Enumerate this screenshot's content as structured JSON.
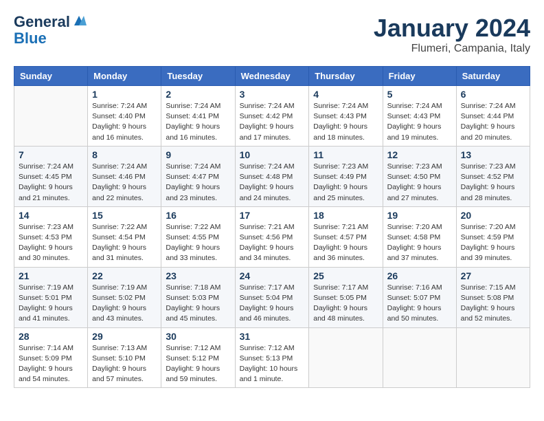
{
  "header": {
    "logo_line1": "General",
    "logo_line2": "Blue",
    "month_title": "January 2024",
    "location": "Flumeri, Campania, Italy"
  },
  "weekdays": [
    "Sunday",
    "Monday",
    "Tuesday",
    "Wednesday",
    "Thursday",
    "Friday",
    "Saturday"
  ],
  "weeks": [
    [
      {
        "day": "",
        "info": ""
      },
      {
        "day": "1",
        "info": "Sunrise: 7:24 AM\nSunset: 4:40 PM\nDaylight: 9 hours\nand 16 minutes."
      },
      {
        "day": "2",
        "info": "Sunrise: 7:24 AM\nSunset: 4:41 PM\nDaylight: 9 hours\nand 16 minutes."
      },
      {
        "day": "3",
        "info": "Sunrise: 7:24 AM\nSunset: 4:42 PM\nDaylight: 9 hours\nand 17 minutes."
      },
      {
        "day": "4",
        "info": "Sunrise: 7:24 AM\nSunset: 4:43 PM\nDaylight: 9 hours\nand 18 minutes."
      },
      {
        "day": "5",
        "info": "Sunrise: 7:24 AM\nSunset: 4:43 PM\nDaylight: 9 hours\nand 19 minutes."
      },
      {
        "day": "6",
        "info": "Sunrise: 7:24 AM\nSunset: 4:44 PM\nDaylight: 9 hours\nand 20 minutes."
      }
    ],
    [
      {
        "day": "7",
        "info": "Sunrise: 7:24 AM\nSunset: 4:45 PM\nDaylight: 9 hours\nand 21 minutes."
      },
      {
        "day": "8",
        "info": "Sunrise: 7:24 AM\nSunset: 4:46 PM\nDaylight: 9 hours\nand 22 minutes."
      },
      {
        "day": "9",
        "info": "Sunrise: 7:24 AM\nSunset: 4:47 PM\nDaylight: 9 hours\nand 23 minutes."
      },
      {
        "day": "10",
        "info": "Sunrise: 7:24 AM\nSunset: 4:48 PM\nDaylight: 9 hours\nand 24 minutes."
      },
      {
        "day": "11",
        "info": "Sunrise: 7:23 AM\nSunset: 4:49 PM\nDaylight: 9 hours\nand 25 minutes."
      },
      {
        "day": "12",
        "info": "Sunrise: 7:23 AM\nSunset: 4:50 PM\nDaylight: 9 hours\nand 27 minutes."
      },
      {
        "day": "13",
        "info": "Sunrise: 7:23 AM\nSunset: 4:52 PM\nDaylight: 9 hours\nand 28 minutes."
      }
    ],
    [
      {
        "day": "14",
        "info": "Sunrise: 7:23 AM\nSunset: 4:53 PM\nDaylight: 9 hours\nand 30 minutes."
      },
      {
        "day": "15",
        "info": "Sunrise: 7:22 AM\nSunset: 4:54 PM\nDaylight: 9 hours\nand 31 minutes."
      },
      {
        "day": "16",
        "info": "Sunrise: 7:22 AM\nSunset: 4:55 PM\nDaylight: 9 hours\nand 33 minutes."
      },
      {
        "day": "17",
        "info": "Sunrise: 7:21 AM\nSunset: 4:56 PM\nDaylight: 9 hours\nand 34 minutes."
      },
      {
        "day": "18",
        "info": "Sunrise: 7:21 AM\nSunset: 4:57 PM\nDaylight: 9 hours\nand 36 minutes."
      },
      {
        "day": "19",
        "info": "Sunrise: 7:20 AM\nSunset: 4:58 PM\nDaylight: 9 hours\nand 37 minutes."
      },
      {
        "day": "20",
        "info": "Sunrise: 7:20 AM\nSunset: 4:59 PM\nDaylight: 9 hours\nand 39 minutes."
      }
    ],
    [
      {
        "day": "21",
        "info": "Sunrise: 7:19 AM\nSunset: 5:01 PM\nDaylight: 9 hours\nand 41 minutes."
      },
      {
        "day": "22",
        "info": "Sunrise: 7:19 AM\nSunset: 5:02 PM\nDaylight: 9 hours\nand 43 minutes."
      },
      {
        "day": "23",
        "info": "Sunrise: 7:18 AM\nSunset: 5:03 PM\nDaylight: 9 hours\nand 45 minutes."
      },
      {
        "day": "24",
        "info": "Sunrise: 7:17 AM\nSunset: 5:04 PM\nDaylight: 9 hours\nand 46 minutes."
      },
      {
        "day": "25",
        "info": "Sunrise: 7:17 AM\nSunset: 5:05 PM\nDaylight: 9 hours\nand 48 minutes."
      },
      {
        "day": "26",
        "info": "Sunrise: 7:16 AM\nSunset: 5:07 PM\nDaylight: 9 hours\nand 50 minutes."
      },
      {
        "day": "27",
        "info": "Sunrise: 7:15 AM\nSunset: 5:08 PM\nDaylight: 9 hours\nand 52 minutes."
      }
    ],
    [
      {
        "day": "28",
        "info": "Sunrise: 7:14 AM\nSunset: 5:09 PM\nDaylight: 9 hours\nand 54 minutes."
      },
      {
        "day": "29",
        "info": "Sunrise: 7:13 AM\nSunset: 5:10 PM\nDaylight: 9 hours\nand 57 minutes."
      },
      {
        "day": "30",
        "info": "Sunrise: 7:12 AM\nSunset: 5:12 PM\nDaylight: 9 hours\nand 59 minutes."
      },
      {
        "day": "31",
        "info": "Sunrise: 7:12 AM\nSunset: 5:13 PM\nDaylight: 10 hours\nand 1 minute."
      },
      {
        "day": "",
        "info": ""
      },
      {
        "day": "",
        "info": ""
      },
      {
        "day": "",
        "info": ""
      }
    ]
  ]
}
